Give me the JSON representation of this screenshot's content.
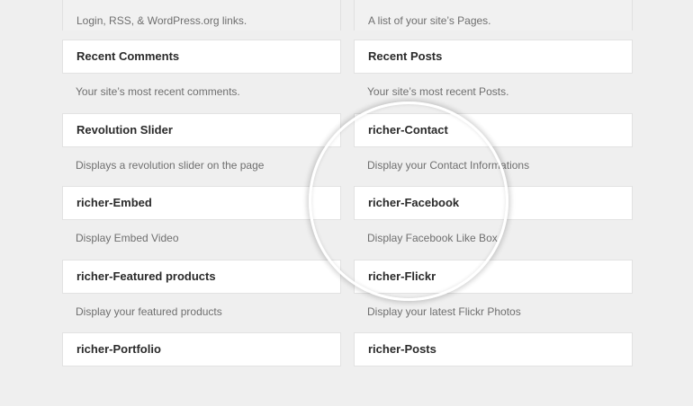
{
  "left_column": {
    "top_description": "Login, RSS, & WordPress.org links.",
    "widgets": [
      {
        "title": "Recent Comments",
        "description": "Your site’s most recent comments."
      },
      {
        "title": "Revolution Slider",
        "description": "Displays a revolution slider on the page"
      },
      {
        "title": "richer-Embed",
        "description": "Display Embed Video"
      },
      {
        "title": "richer-Featured products",
        "description": "Display your featured products"
      },
      {
        "title": "richer-Portfolio",
        "description": ""
      }
    ]
  },
  "right_column": {
    "top_description": "A list of your site’s Pages.",
    "widgets": [
      {
        "title": "Recent Posts",
        "description": "Your site’s most recent Posts."
      },
      {
        "title": "richer-Contact",
        "description": "Display your Contact Informations"
      },
      {
        "title": "richer-Facebook",
        "description": "Display Facebook Like Box"
      },
      {
        "title": "richer-Flickr",
        "description": "Display your latest Flickr Photos"
      },
      {
        "title": "richer-Posts",
        "description": ""
      }
    ]
  }
}
